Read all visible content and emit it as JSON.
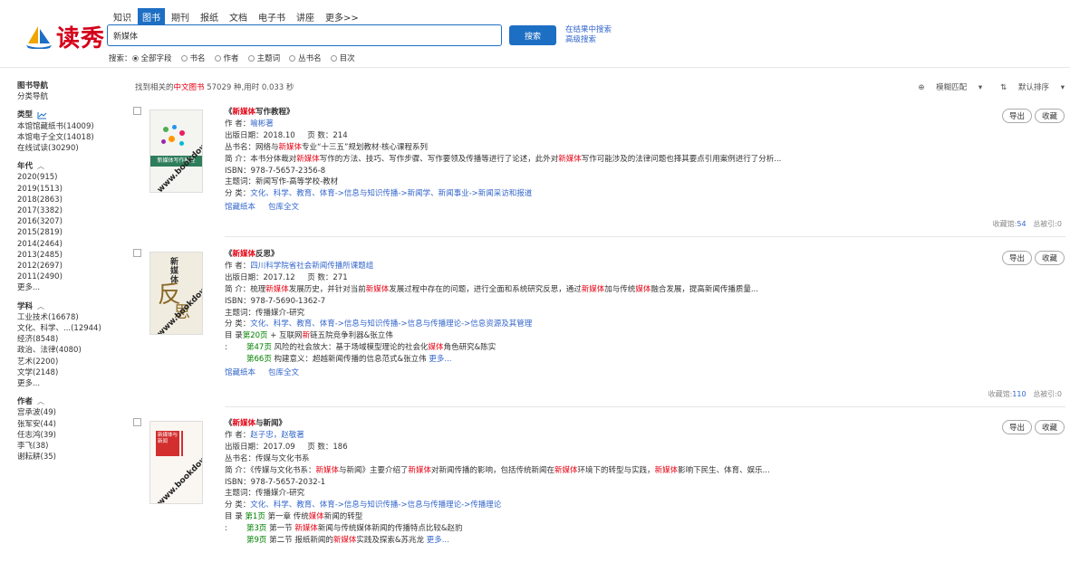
{
  "logo": {
    "text": "读秀"
  },
  "tabs": [
    "知识",
    "图书",
    "期刊",
    "报纸",
    "文档",
    "电子书",
    "讲座",
    "更多>>"
  ],
  "search": {
    "value": "新媒体",
    "button": "搜索",
    "in_results": "在结果中搜索",
    "advanced": "高级搜索"
  },
  "search_scope": {
    "label": "搜索：",
    "options": [
      "全部字段",
      "书名",
      "作者",
      "主题词",
      "丛书名",
      "目次"
    ],
    "selected": "全部字段"
  },
  "sidebar": {
    "nav_title": "图书导航",
    "nav_sub": "分类导航",
    "type": {
      "title": "类型",
      "items": [
        "本馆馆藏纸书(14009)",
        "本馆电子全文(14018)",
        "在线试读(30290)"
      ]
    },
    "year": {
      "title": "年代",
      "items": [
        "2020(915)",
        "2019(1513)",
        "2018(2863)",
        "2017(3382)",
        "2016(3207)",
        "2015(2819)",
        "2014(2464)",
        "2013(2485)",
        "2012(2697)",
        "2011(2490)",
        "更多..."
      ]
    },
    "subject": {
      "title": "学科",
      "items": [
        "工业技术(16678)",
        "文化、科学、...(12944)",
        "经济(8548)",
        "政治、法律(4080)",
        "艺术(2200)",
        "文学(2148)",
        "更多..."
      ]
    },
    "author": {
      "title": "作者",
      "items": [
        "宫承波(49)",
        "张军安(44)",
        "任志鸿(39)",
        "李飞(38)",
        "谢耘耕(35)"
      ]
    }
  },
  "summary": {
    "prefix": "找到相关的",
    "highlight": "中文图书",
    "rest": " 57029 种,用时 0.033 秒"
  },
  "sort": {
    "match": "模糊匹配",
    "order": "默认排序"
  },
  "results": [
    {
      "title_pre": "《",
      "title_hl": "新媒体",
      "title_post": "写作教程》",
      "author_label": "作 者：",
      "author": "喻彬著",
      "date_label": "出版日期：",
      "date": "2018.10",
      "pages_label": "页 数：",
      "pages": "214",
      "series_label": "丛书名：",
      "series_pre": "网络与",
      "series_hl": "新媒体",
      "series_post": "专业“十三五”规划教材·核心课程系列",
      "intro_label": "简 介：",
      "intro_1": "本书分体裁对",
      "intro_hl1": "新媒体",
      "intro_2": "写作的方法、技巧、写作步骤、写作要领及传播等进行了论述，此外对",
      "intro_hl2": "新媒体",
      "intro_3": "写作可能涉及的法律问题也择其要点引用案例进行了分析...",
      "isbn_label": "ISBN：",
      "isbn": "978-7-5657-2356-8",
      "subject_label": "主题词：",
      "subject": "新闻写作-高等学校-教材",
      "class_label": "分 类：",
      "class": "文化、科学、教育、体育->信息与知识传播->新闻学、新闻事业->新闻采访和报道",
      "ops": [
        "馆藏纸本",
        "包库全文"
      ],
      "cover_title": "新媒体写作教程",
      "watermark": "www.bookdown.com.cn",
      "stats_1": "收藏馆:",
      "stats_1n": "54",
      "stats_2": "总被引:0"
    },
    {
      "title_pre": "《",
      "title_hl": "新媒体",
      "title_post": "反思》",
      "author_label": "作 者：",
      "author": "四川科学院省社会新闻传播所课题组",
      "date_label": "出版日期：",
      "date": "2017.12",
      "pages_label": "页 数：",
      "pages": "271",
      "intro_label": "简 介：",
      "intro_1": "梳理",
      "intro_hl1": "新媒体",
      "intro_2": "发展历史，并针对当前",
      "intro_hl2": "新媒体",
      "intro_3": "发展过程中存在的问题，进行全面和系统研究反思，通过",
      "intro_hl3": "新媒体",
      "intro_4": "加与传统",
      "intro_hl4": "媒体",
      "intro_5": "融合发展，提高新闻传播质量...",
      "isbn_label": "ISBN：",
      "isbn": "978-7-5690-1362-7",
      "subject_label": "主题词：",
      "subject": "传播媒介-研究",
      "class_label": "分 类：",
      "class": "文化、科学、教育、体育->信息与知识传播->信息与传播理论->信息资源及其管理",
      "toc_label": "目 录",
      "toc": [
        {
          "page": "第20页",
          "pre": " + 互联网",
          "hl": "新",
          "post": "链五院竞争利器&张立伟"
        },
        {
          "page": "第47页",
          "pre": " 风险的社会放大：基于场域模型理论的社会化",
          "hl": "媒体",
          "post": "角色研究&陈实"
        },
        {
          "page": "第66页",
          "pre": " 构建意义：超越新闻传播的信息范式&张立伟 ",
          "hl": "",
          "post": "",
          "more": "更多..."
        }
      ],
      "ops": [
        "馆藏纸本",
        "包库全文"
      ],
      "cover_title": "新媒体",
      "watermark": "www.bookdown.com.cn",
      "stats_1": "收藏馆:",
      "stats_1n": "110",
      "stats_2": "总被引:0"
    },
    {
      "title_pre": "《",
      "title_hl": "新媒体",
      "title_post": "与新闻》",
      "author_label": "作 者：",
      "author": "赵子忠，赵敬著",
      "date_label": "出版日期：",
      "date": "2017.09",
      "pages_label": "页 数：",
      "pages": "186",
      "series_label": "丛书名：",
      "series_pre": "传媒与文化书系",
      "series_hl": "",
      "series_post": "",
      "intro_label": "简 介：",
      "intro_1": "《传媒与文化书系：",
      "intro_hl1": "新媒体",
      "intro_2": "与新闻》主要介绍了",
      "intro_hl2": "新媒体",
      "intro_3": "对新闻传播的影响，包括传统新闻在",
      "intro_hl3": "新媒体",
      "intro_4": "环境下的转型与实践，",
      "intro_hl4": "新媒体",
      "intro_5": "影响下民生、体育、娱乐...",
      "isbn_label": "ISBN：",
      "isbn": "978-7-5657-2032-1",
      "subject_label": "主题词：",
      "subject": "传播媒介-研究",
      "class_label": "分 类：",
      "class": "文化、科学、教育、体育->信息与知识传播->信息与传播理论->传播理论",
      "toc_label": "目 录",
      "toc": [
        {
          "page": "第1页",
          "pre": " 第一章 传统",
          "hl": "媒体",
          "post": "新闻的转型"
        },
        {
          "page": "第3页",
          "pre": " 第一节 ",
          "hl": "新媒体",
          "post": "新闻与传统媒体新闻的传播特点比较&赵豹"
        },
        {
          "page": "第9页",
          "pre": " 第二节 报纸新闻的",
          "hl": "新媒体",
          "post": "实践及探索&苏兆龙 ",
          "more": "更多..."
        }
      ],
      "cover_title": "新媒体与新闻",
      "watermark": "www.bookdown.com.cn"
    }
  ],
  "common": {
    "export": "导出",
    "collect": "收藏"
  },
  "colors": {
    "brand": "#1d6fc4",
    "highlight": "#e60012",
    "link": "#3366cc"
  }
}
